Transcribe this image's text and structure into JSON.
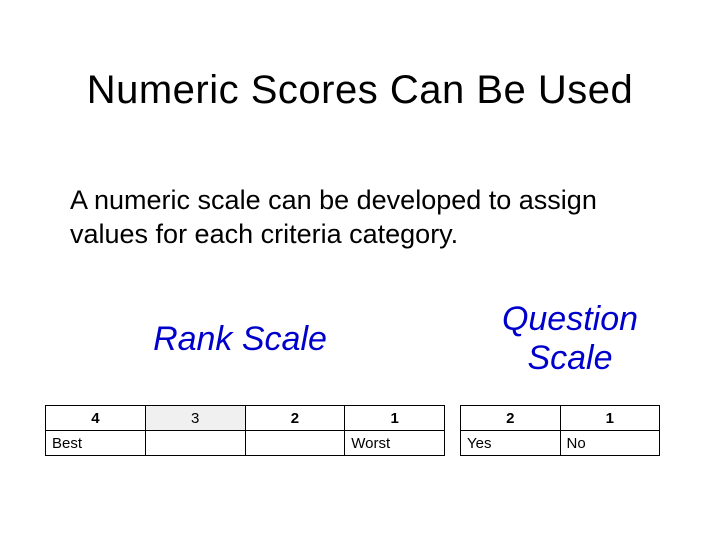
{
  "title": "Numeric Scores Can Be Used",
  "body": "A numeric scale can be developed to assign values for each criteria category.",
  "rank_heading": "Rank Scale",
  "question_heading": "Question Scale",
  "rank": {
    "n1": "4",
    "n2": "3",
    "n3": "2",
    "n4": "1",
    "l1": "Best",
    "l2": "",
    "l3": "",
    "l4": "Worst"
  },
  "question": {
    "n1": "2",
    "n2": "1",
    "l1": "Yes",
    "l2": "No"
  }
}
